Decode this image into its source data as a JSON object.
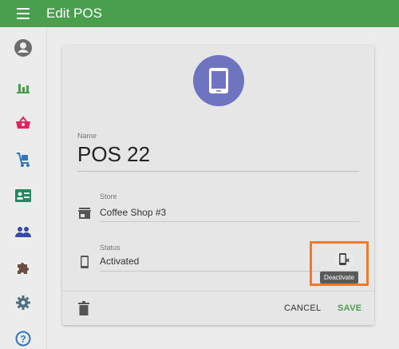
{
  "appbar": {
    "title": "Edit POS",
    "menu_icon": "menu-icon"
  },
  "sidebar": {
    "items": [
      {
        "icon": "account-circle-icon",
        "color": "#6d6d6d"
      },
      {
        "icon": "bar-chart-icon",
        "color": "#4a9f4f"
      },
      {
        "icon": "basket-icon",
        "color": "#e0245e"
      },
      {
        "icon": "cart-icon",
        "color": "#2f74c0"
      },
      {
        "icon": "id-card-icon",
        "color": "#1f8a62"
      },
      {
        "icon": "people-icon",
        "color": "#3948ab"
      },
      {
        "icon": "puzzle-icon",
        "color": "#6d4c41"
      },
      {
        "icon": "gear-icon",
        "color": "#4f6f80"
      },
      {
        "icon": "help-icon",
        "color": "#2f74c0"
      }
    ]
  },
  "form": {
    "avatar_icon": "tablet-icon",
    "name_label": "Name",
    "name_value": "POS 22",
    "store_label": "Store",
    "store_value": "Coffee Shop #3",
    "status_label": "Status",
    "status_value": "Activated"
  },
  "deactivate": {
    "tooltip": "Deactivate",
    "icon": "phone-off-icon"
  },
  "actions": {
    "cancel": "CANCEL",
    "save": "SAVE"
  },
  "colors": {
    "primary": "#4a9f4f",
    "avatar": "#6f74c0",
    "highlight": "#ee7a2b"
  }
}
